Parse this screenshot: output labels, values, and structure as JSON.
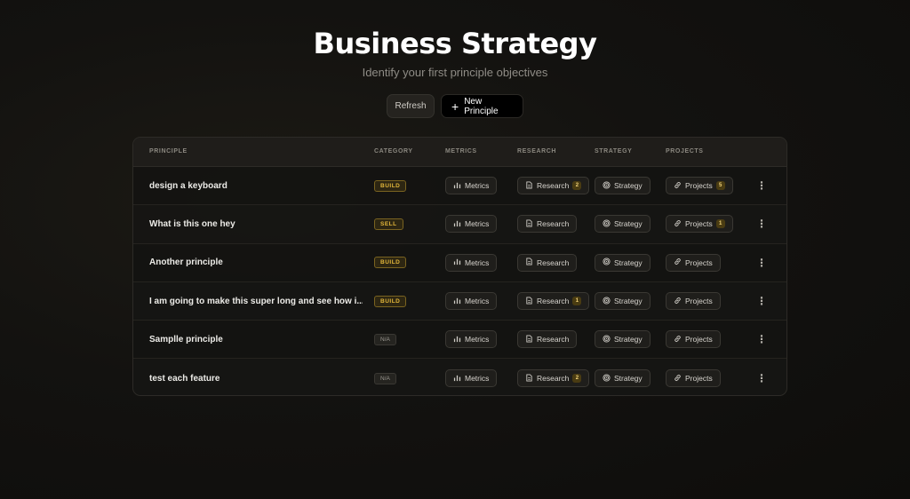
{
  "header": {
    "title": "Business Strategy",
    "subtitle": "Identify your first principle objectives"
  },
  "actions": {
    "refresh_label": "Refresh",
    "new_label": "New Principle"
  },
  "columns": [
    "PRINCIPLE",
    "CATEGORY",
    "METRICS",
    "RESEARCH",
    "STRATEGY",
    "PROJECTS"
  ],
  "labels": {
    "metrics": "Metrics",
    "research": "Research",
    "strategy": "Strategy",
    "projects": "Projects"
  },
  "rows": [
    {
      "name": "design a keyboard",
      "category": "BUILD",
      "research_count": "2",
      "projects_count": "5"
    },
    {
      "name": "What is this one hey",
      "category": "SELL",
      "research_count": "",
      "projects_count": "1"
    },
    {
      "name": "Another principle",
      "category": "BUILD",
      "research_count": "",
      "projects_count": ""
    },
    {
      "name": "I am going to make this super long and see how i...",
      "category": "BUILD",
      "research_count": "1",
      "projects_count": ""
    },
    {
      "name": "Samplle principle",
      "category": "N/A",
      "research_count": "",
      "projects_count": ""
    },
    {
      "name": "test each feature",
      "category": "N/A",
      "research_count": "2",
      "projects_count": ""
    }
  ],
  "icons": {
    "metrics": "bar-chart-icon",
    "research": "document-icon",
    "strategy": "target-icon",
    "projects": "link-icon",
    "more": "more-vertical-icon",
    "add": "plus-icon"
  },
  "colors": {
    "accent_gold": "#e3b73a",
    "background": "#131210"
  }
}
